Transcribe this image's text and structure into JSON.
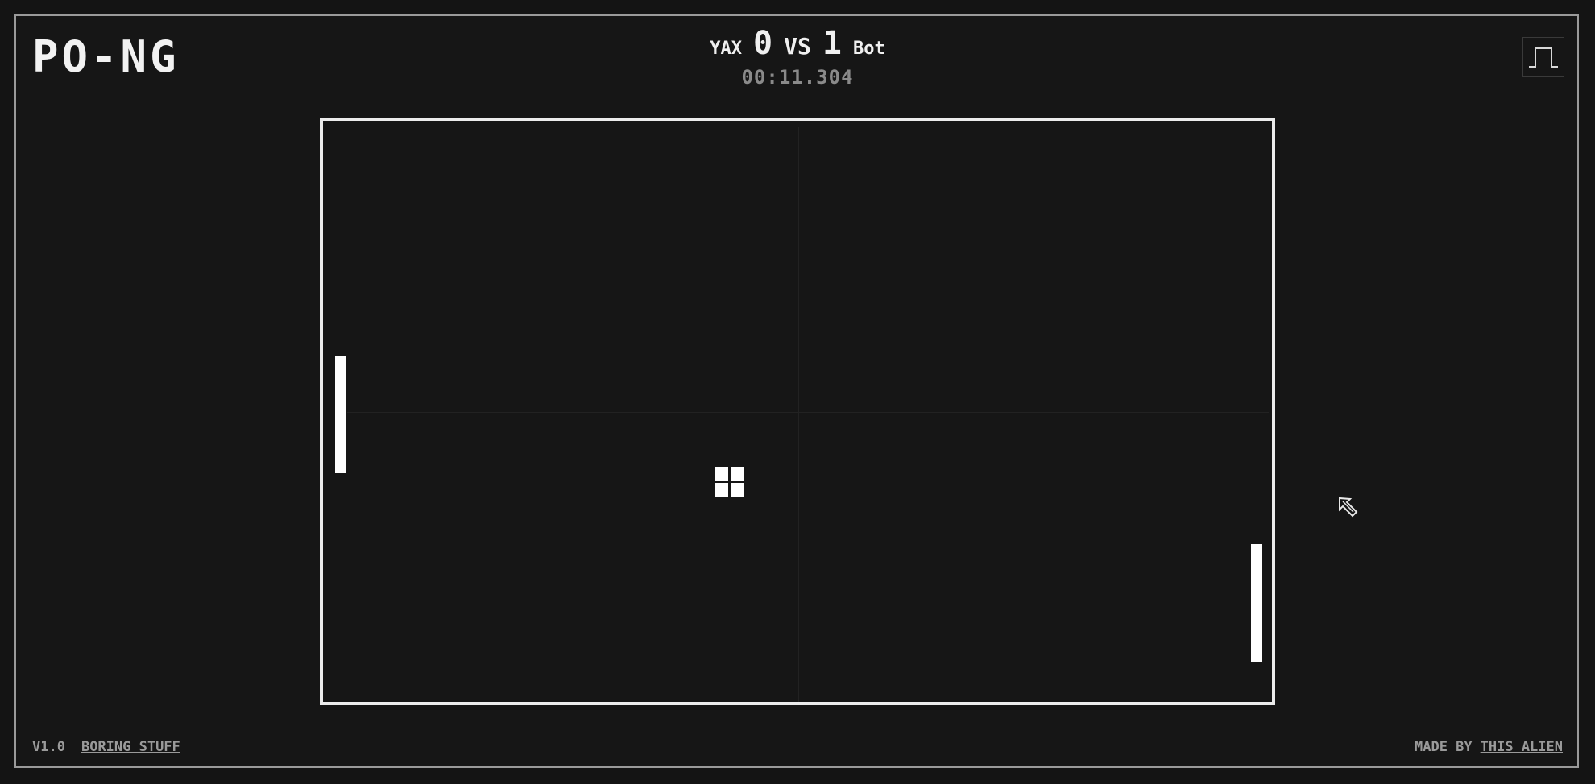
{
  "app": {
    "logo": "PO-NG"
  },
  "scoreboard": {
    "player1": {
      "name": "YAX",
      "score": "0"
    },
    "vs": "VS",
    "player2": {
      "name": "Bot",
      "score": "1"
    },
    "timer": "00:11.304"
  },
  "controls": {
    "sound_icon": "square-wave-icon"
  },
  "footer": {
    "version": "V1.0",
    "boring_link": "BORING STUFF",
    "made_by": "MADE BY",
    "author_link": "THIS ALIEN"
  },
  "colors": {
    "background": "#141414",
    "court_border": "#ececec",
    "paddle": "#ffffff",
    "ball": "#ffffff",
    "timer": "#8a8a8a"
  }
}
